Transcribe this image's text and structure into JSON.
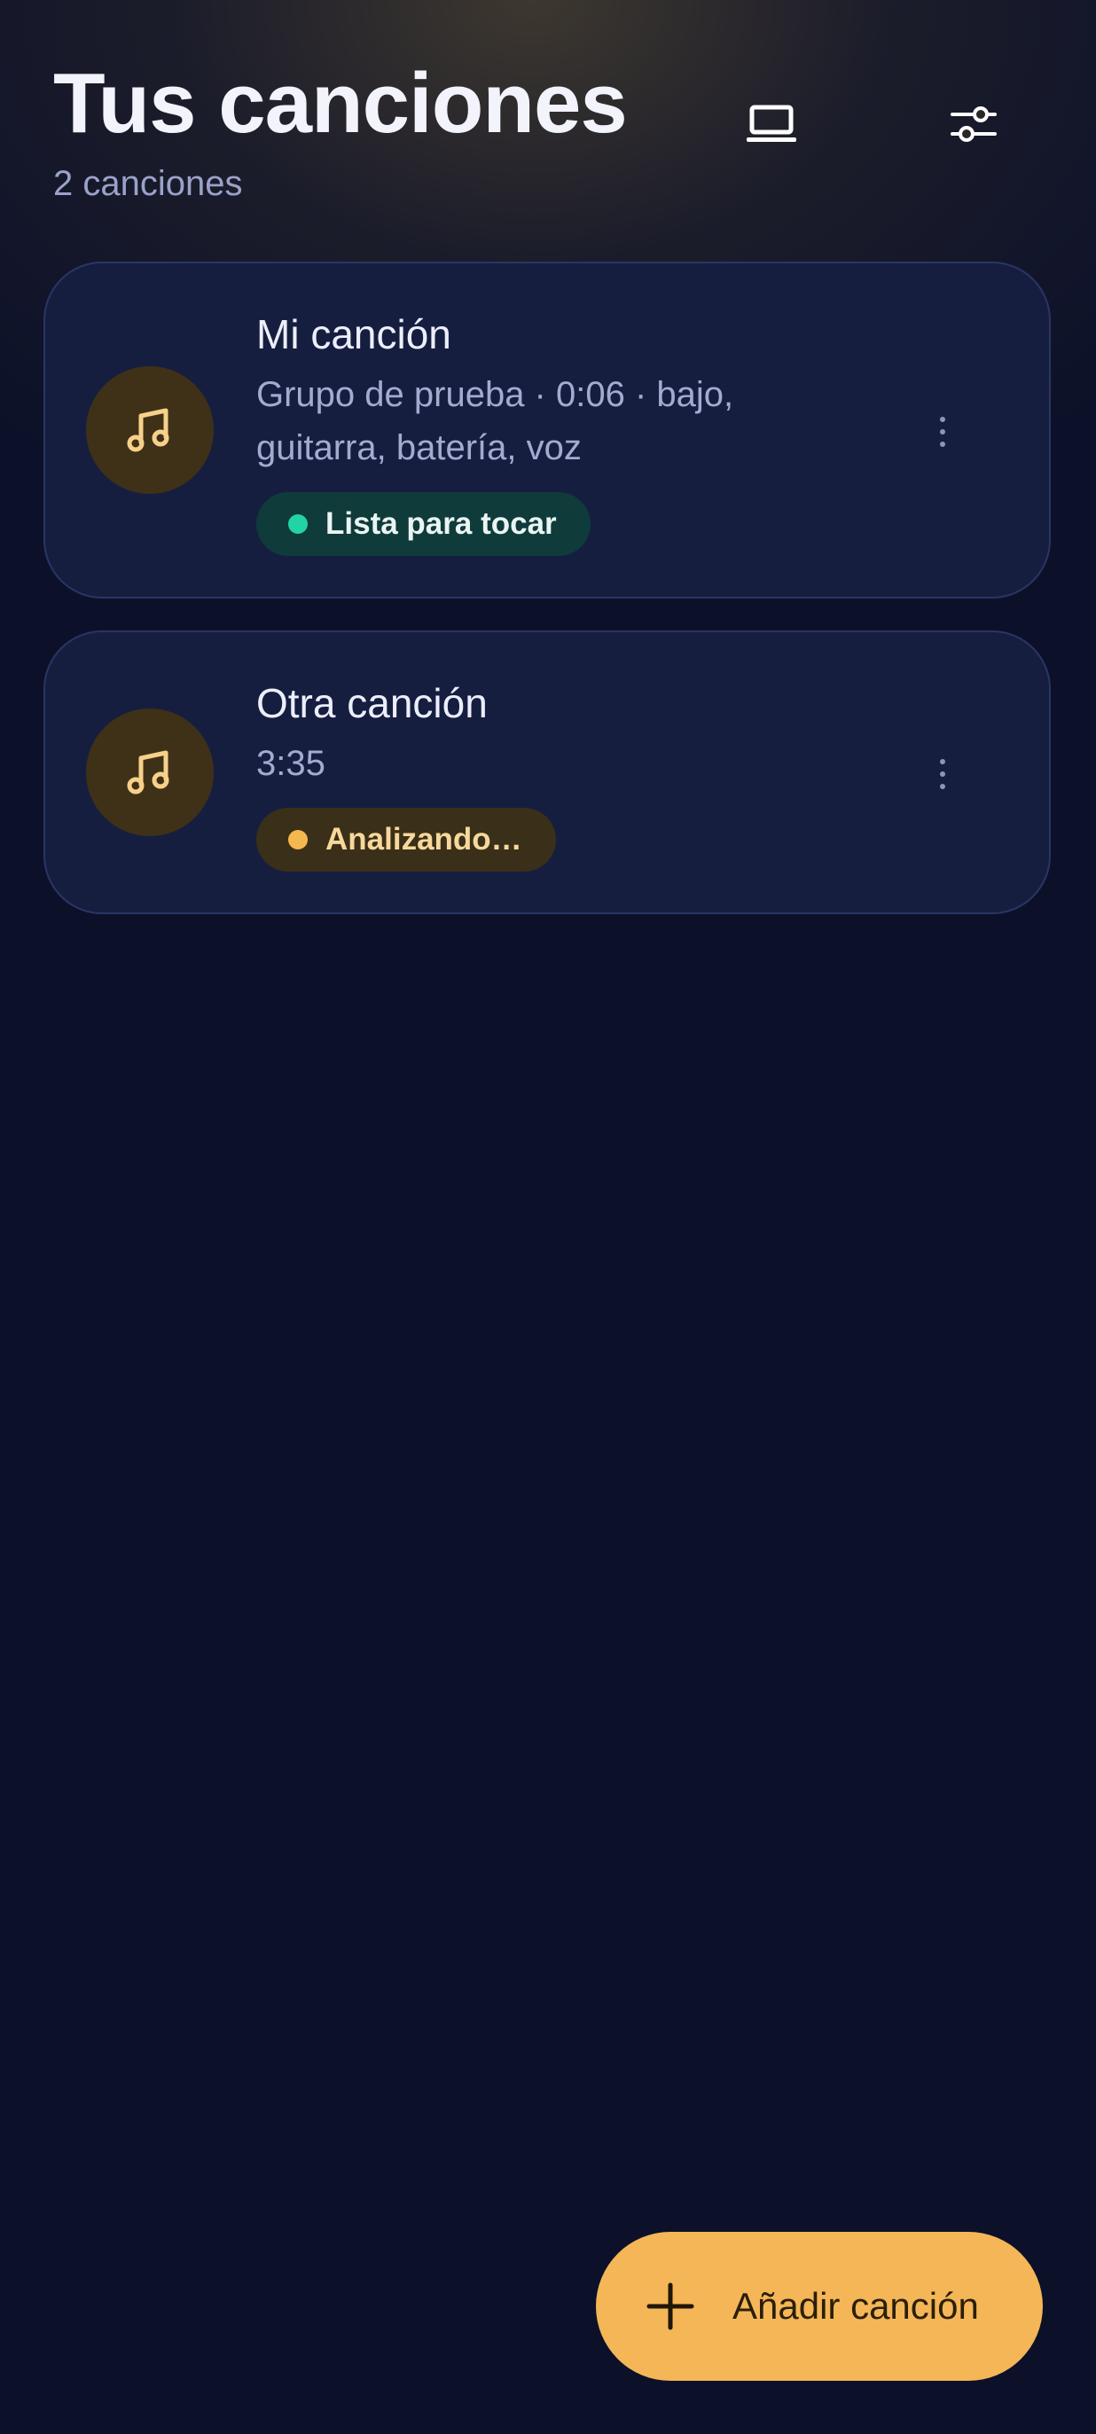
{
  "header": {
    "title": "Tus canciones",
    "subtitle": "2 canciones",
    "laptop_icon": "laptop-icon",
    "filter_icon": "sliders-icon"
  },
  "songs": [
    {
      "title": "Mi canción",
      "meta": "Grupo de prueba · 0:06 · bajo, guitarra, batería, voz",
      "status": "Lista para tocar",
      "status_color": "#22d3a5",
      "icon": "music-note-icon"
    },
    {
      "title": "Otra canción",
      "meta": "3:35",
      "status": "Analizando…",
      "status_color": "#f5b84f",
      "icon": "music-note-icon"
    }
  ],
  "fab": {
    "label": "Añadir canción",
    "icon": "plus-icon"
  },
  "colors": {
    "accent": "#f5b657",
    "background": "#0c1129",
    "card": "#161e40"
  }
}
